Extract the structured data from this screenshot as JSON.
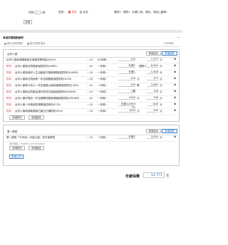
{
  "header": {
    "age_value": "年齡",
    "age_unit": "歲",
    "gender_label": "性別：",
    "gender_options": [
      "男性",
      "女性"
    ],
    "gender_selected": "男性",
    "tier_label": "醫院1：醫院1（內鏡人員，需自，或說上證單）",
    "add_button": "新增"
  },
  "section1": {
    "title": "高達的理賠數據明",
    "collapse_icon": "minus-icon",
    "options": [
      "顯示保險期間",
      "顯示要點項目"
    ],
    "right_note": "列印報告",
    "group_label": "台灣人壽",
    "btn_copy": "數值組合",
    "btn_add": "新增保險",
    "rows": [
      {
        "type": "",
        "name": "台灣人壽新健康醫療日領保險實物給付(HH)",
        "years": "20",
        "term": "20年期",
        "amount": "100",
        "unit": "",
        "premium": "1,374",
        "unit2": "元"
      },
      {
        "type": "附約",
        "name": "台灣人壽新住院醫療保險附約(HNRC)",
        "years": "20",
        "term": "一年期",
        "amount": "計畫1",
        "unit": "（實際１日實）",
        "premium": "8,442",
        "unit2": "元"
      },
      {
        "type": "附約",
        "name": "台灣人壽新美好人生自動給付醫療健康保險附約(HMSR)",
        "years": "20",
        "term": "一年期",
        "amount": "計畫1",
        "unit": "",
        "premium": "1,808",
        "unit2": "元"
      },
      {
        "type": "附約",
        "name": "台灣人壽新住院病房一年定期醫療保險附約(HCM)",
        "years": "20",
        "term": "一年期",
        "amount": "100",
        "unit": "元",
        "premium": "375",
        "unit2": "元"
      },
      {
        "type": "附約",
        "name": "台灣人壽新平安心一年定期重大傷病健康保險附約(CRH)",
        "years": "20",
        "term": "一年期",
        "amount": "100",
        "unit": "萬",
        "premium": "2,880",
        "unit2": "元"
      },
      {
        "type": "附約",
        "name": "台灣人壽新住院重症事件型意外傷害保險附約(DMHR)",
        "years": "20",
        "term": "一年期",
        "amount": "1萬",
        "unit": "",
        "premium": "708",
        "unit2": "元"
      },
      {
        "type": "附約",
        "name": "台灣人壽好實品一年定期關貸醫療健康保險附約(YRCBR)",
        "years": "20",
        "term": "一年期",
        "amount": "1000",
        "unit": "元",
        "premium": "708",
        "unit2": "元"
      },
      {
        "type": "附約",
        "name": "台灣人壽一年期超防健康保險附約(FCR)",
        "years": "20",
        "term": "一年期",
        "amount": "計畫1(2000元)",
        "unit": "",
        "premium": "848",
        "unit2": "元"
      },
      {
        "type": "附約",
        "name": "台灣人壽新福衛醫療日當日日額附約(ELR)",
        "years": "20",
        "term": "一年期",
        "amount": "1000",
        "unit": "元",
        "premium": "335",
        "unit2": "元"
      }
    ],
    "foot_buttons": [
      "新增附約",
      "新增產品"
    ]
  },
  "section2": {
    "group_label": "第一壽險",
    "btn_copy": "數值組合",
    "btn_add": "新增保險",
    "rows": [
      {
        "type": "",
        "name": "第一壽險「平安保一切皆久案」意外保障險",
        "years": "20",
        "term": "一年期",
        "amount": "計畫1",
        "unit": "",
        "premium": "3,490",
        "unit2": "元"
      }
    ],
    "partner_note": "合作連結：firstlife.com.tw/xxxxx",
    "foot_buttons": [
      "新增附約",
      "新增產品"
    ],
    "add_company": "新增公司"
  },
  "total": {
    "label": "年繳保費",
    "value": "14,771",
    "unit": "元"
  }
}
